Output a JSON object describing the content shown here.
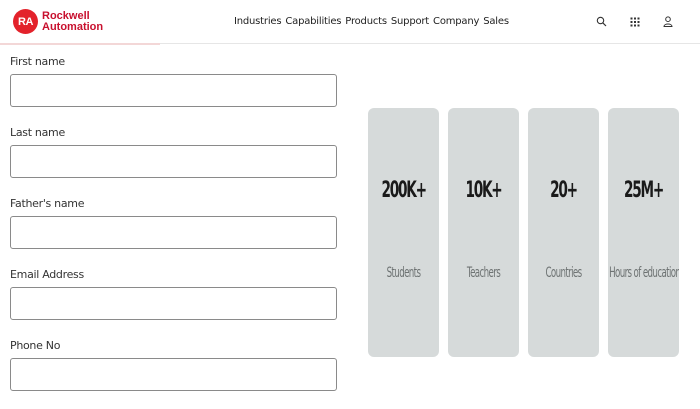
{
  "header": {
    "logo": {
      "badge": "RA",
      "line1": "Rockwell",
      "line2": "Automation"
    },
    "nav": [
      "Industries",
      "Capabilities",
      "Products",
      "Support",
      "Company",
      "Sales"
    ],
    "icons": [
      "search-icon",
      "grid-icon",
      "user-icon"
    ]
  },
  "form": {
    "fields": [
      {
        "label": "First name",
        "value": ""
      },
      {
        "label": "Last name",
        "value": ""
      },
      {
        "label": "Father's name",
        "value": ""
      },
      {
        "label": "Email Address",
        "value": ""
      },
      {
        "label": "Phone No",
        "value": ""
      }
    ]
  },
  "stats": [
    {
      "value": "200K+",
      "label": "Students"
    },
    {
      "value": "10K+",
      "label": "Teachers"
    },
    {
      "value": "20+",
      "label": "Countries"
    },
    {
      "value": "25M+",
      "label": "Hours of education"
    }
  ],
  "colors": {
    "brand": "#e3222b",
    "card": "#d6dada"
  }
}
